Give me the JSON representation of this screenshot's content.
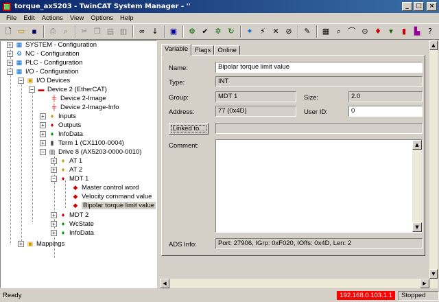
{
  "window": {
    "title": "torque_ax5203 - TwinCAT System Manager - ''"
  },
  "menu": [
    "File",
    "Edit",
    "Actions",
    "View",
    "Options",
    "Help"
  ],
  "toolbar_icons": [
    "new-icon",
    "open-icon",
    "save-icon",
    "print-icon",
    "print-preview-icon",
    "cut-icon",
    "copy-icon",
    "paste-icon",
    "paste-special-icon",
    "find-icon",
    "find-next-icon",
    "monitor-icon",
    "target-icon",
    "check-icon",
    "activate-icon",
    "restart-icon",
    "config-mode-icon",
    "scan-icon",
    "toggle-icon",
    "link-icon",
    "search-icon",
    "zoom-icon",
    "online-icon",
    "glasses-icon",
    "arrow-icon",
    "lock-icon",
    "help-icon"
  ],
  "tree": {
    "items": [
      {
        "label": "SYSTEM - Configuration"
      },
      {
        "label": "NC - Configuration"
      },
      {
        "label": "PLC - Configuration"
      },
      {
        "label": "I/O - Configuration"
      },
      {
        "label": "I/O Devices"
      },
      {
        "label": "Device 2 (EtherCAT)"
      },
      {
        "label": "Device 2-Image"
      },
      {
        "label": "Device 2-Image-Info"
      },
      {
        "label": "Inputs"
      },
      {
        "label": "Outputs"
      },
      {
        "label": "InfoData"
      },
      {
        "label": "Term 1 (CX1100-0004)"
      },
      {
        "label": "Drive 8 (AX5203-0000-0010)"
      },
      {
        "label": "AT 1"
      },
      {
        "label": "AT 2"
      },
      {
        "label": "MDT 1"
      },
      {
        "label": "Master control word"
      },
      {
        "label": "Velocity command value"
      },
      {
        "label": "Bipolar torque limit value"
      },
      {
        "label": "MDT 2"
      },
      {
        "label": "WcState"
      },
      {
        "label": "InfoData"
      },
      {
        "label": "Mappings"
      }
    ]
  },
  "tabs": [
    "Variable",
    "Flags",
    "Online"
  ],
  "form": {
    "name_label": "Name:",
    "name_value": "Bipolar torque limit value",
    "type_label": "Type:",
    "type_value": "INT",
    "group_label": "Group:",
    "group_value": "MDT 1",
    "size_label": "Size:",
    "size_value": "2.0",
    "address_label": "Address:",
    "address_value": "77 (0x4D)",
    "userid_label": "User ID:",
    "userid_value": "0",
    "linked_button": "Linked to...",
    "linked_value": "",
    "comment_label": "Comment:",
    "comment_value": "",
    "ads_label": "ADS Info:",
    "ads_value": "Port: 27906, IGrp: 0xF020, IOffs: 0x4D, Len: 2"
  },
  "status": {
    "ready": "Ready",
    "ip": "192.168.0.103.1.1",
    "state": "Stopped"
  }
}
